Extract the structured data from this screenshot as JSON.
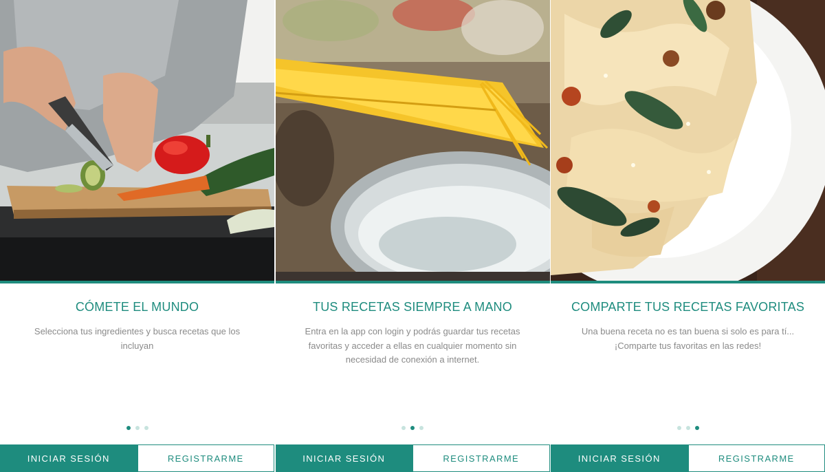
{
  "colors": {
    "accent": "#1e8c7e",
    "text_muted": "#8a8a8a",
    "dot_inactive": "#c7e3de"
  },
  "screens": [
    {
      "image": "vegetables-cutting-board-photo",
      "title": "CÓMETE EL MUNDO",
      "description": "Selecciona tus ingredientes y busca recetas que los incluyan",
      "active_page": 1,
      "page_count": 3,
      "login_label": "INICIAR SESIÓN",
      "register_label": "REGISTRARME"
    },
    {
      "image": "spaghetti-over-pot-photo",
      "title": "TUS RECETAS SIEMPRE A MANO",
      "description": "Entra en la app con login y podrás guardar tus recetas favoritas y acceder a ellas en cualquier momento sin necesidad de conexión a internet.",
      "active_page": 2,
      "page_count": 3,
      "login_label": "INICIAR SESIÓN",
      "register_label": "REGISTRARME"
    },
    {
      "image": "pasta-dish-photo",
      "title": "COMPARTE TUS RECETAS FAVORITAS",
      "description": "Una buena receta no es tan buena si solo es para tí... ¡Comparte tus favoritas en las redes!",
      "active_page": 3,
      "page_count": 3,
      "login_label": "INICIAR SESIÓN",
      "register_label": "REGISTRARME"
    }
  ]
}
